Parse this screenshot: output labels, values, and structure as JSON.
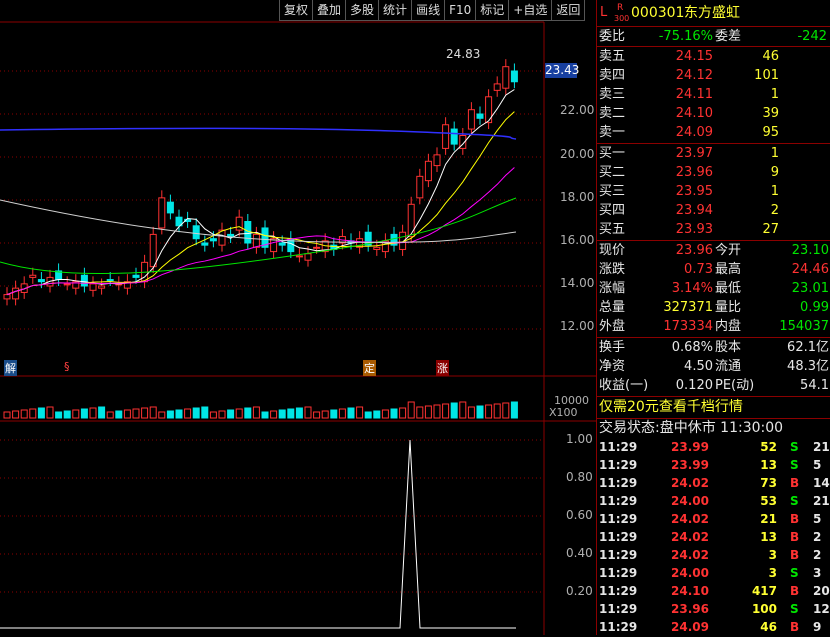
{
  "toolbar": [
    "复权",
    "叠加",
    "多股",
    "统计",
    "画线",
    "F10",
    "标记",
    "+自选",
    "返回"
  ],
  "stock": {
    "badge_l": "L",
    "badge_r": "R",
    "badge_num": "300",
    "code": "000301",
    "name": "东方盛虹"
  },
  "weibi": {
    "label": "委比",
    "value": "-75.16%",
    "label2": "委差",
    "value2": "-242"
  },
  "sell": [
    {
      "label": "卖五",
      "price": "24.15",
      "vol": "46"
    },
    {
      "label": "卖四",
      "price": "24.12",
      "vol": "101"
    },
    {
      "label": "卖三",
      "price": "24.11",
      "vol": "1"
    },
    {
      "label": "卖二",
      "price": "24.10",
      "vol": "39"
    },
    {
      "label": "卖一",
      "price": "24.09",
      "vol": "95"
    }
  ],
  "buy": [
    {
      "label": "买一",
      "price": "23.97",
      "vol": "1"
    },
    {
      "label": "买二",
      "price": "23.96",
      "vol": "9"
    },
    {
      "label": "买三",
      "price": "23.95",
      "vol": "1"
    },
    {
      "label": "买四",
      "price": "23.94",
      "vol": "2"
    },
    {
      "label": "买五",
      "price": "23.93",
      "vol": "27"
    }
  ],
  "quote": [
    {
      "l1": "现价",
      "v1": "23.96",
      "c1": "red",
      "l2": "今开",
      "v2": "23.10",
      "c2": "green"
    },
    {
      "l1": "涨跌",
      "v1": "0.73",
      "c1": "red",
      "l2": "最高",
      "v2": "24.46",
      "c2": "red"
    },
    {
      "l1": "涨幅",
      "v1": "3.14%",
      "c1": "red",
      "l2": "最低",
      "v2": "23.01",
      "c2": "green"
    },
    {
      "l1": "总量",
      "v1": "327371",
      "c1": "yellow",
      "l2": "量比",
      "v2": "0.99",
      "c2": "green"
    },
    {
      "l1": "外盘",
      "v1": "173334",
      "c1": "red",
      "l2": "内盘",
      "v2": "154037",
      "c2": "green"
    }
  ],
  "finance": [
    {
      "l1": "换手",
      "v1": "0.68%",
      "l2": "股本",
      "v2": "62.1亿"
    },
    {
      "l1": "净资",
      "v1": "4.50",
      "l2": "流通",
      "v2": "48.3亿"
    },
    {
      "l1": "收益(一)",
      "v1": "0.120",
      "l2": "PE(动)",
      "v2": "54.1"
    }
  ],
  "promo": "仅需20元查看千档行情",
  "trade_status": "交易状态:盘中休市 11:30:00",
  "ticks": [
    {
      "t": "11:29",
      "p": "23.99",
      "v": "52",
      "s": "S",
      "n": "21"
    },
    {
      "t": "11:29",
      "p": "23.99",
      "v": "13",
      "s": "S",
      "n": "5"
    },
    {
      "t": "11:29",
      "p": "24.02",
      "v": "73",
      "s": "B",
      "n": "14"
    },
    {
      "t": "11:29",
      "p": "24.00",
      "v": "53",
      "s": "S",
      "n": "21"
    },
    {
      "t": "11:29",
      "p": "24.02",
      "v": "21",
      "s": "B",
      "n": "5"
    },
    {
      "t": "11:29",
      "p": "24.02",
      "v": "13",
      "s": "B",
      "n": "2"
    },
    {
      "t": "11:29",
      "p": "24.02",
      "v": "3",
      "s": "B",
      "n": "2"
    },
    {
      "t": "11:29",
      "p": "24.00",
      "v": "3",
      "s": "S",
      "n": "3"
    },
    {
      "t": "11:29",
      "p": "24.10",
      "v": "417",
      "s": "B",
      "n": "20"
    },
    {
      "t": "11:29",
      "p": "23.96",
      "v": "100",
      "s": "S",
      "n": "12"
    },
    {
      "t": "11:29",
      "p": "24.09",
      "v": "46",
      "s": "B",
      "n": "9"
    }
  ],
  "kline": {
    "price_ticks": [
      "22.00",
      "20.00",
      "18.00",
      "16.00",
      "14.00",
      "12.00"
    ],
    "current_price": "23.43",
    "high_marker": "24.83",
    "events": [
      "解",
      "§",
      "定",
      "涨"
    ],
    "vol_scale": "10000",
    "vol_unit": "X100",
    "ind_ticks": [
      "1.00",
      "0.80",
      "0.60",
      "0.40",
      "0.20"
    ],
    "colors": {
      "up": "#ff3232",
      "down": "#00e6e6",
      "ma5": "#ffffff",
      "ma10": "#ffff00",
      "ma20": "#ff00ff",
      "ma60": "#00e600",
      "ma120": "#d0d0d0",
      "ma250": "#3030ff"
    }
  }
}
